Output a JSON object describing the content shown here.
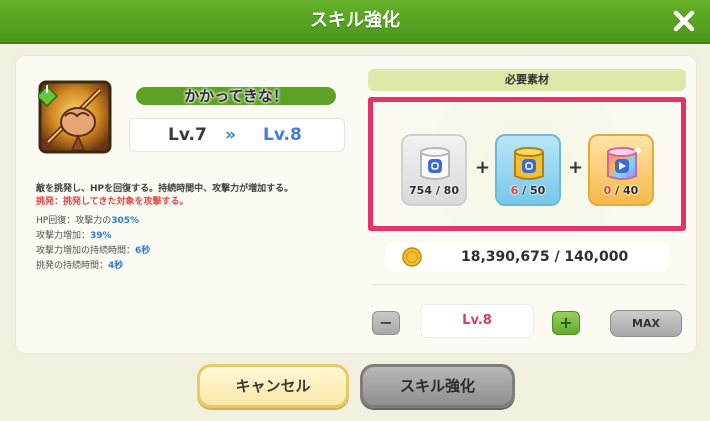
{
  "header": {
    "title": "スキル強化",
    "close_icon": "close-icon"
  },
  "skill": {
    "icon": "skill-fist-icon",
    "name": "かかってきな！",
    "level_current": "Lv.7",
    "level_arrows": "»",
    "level_next": "Lv.8",
    "description": "敵を挑発し、HPを回復する。持続時間中、攻撃力が増加する。",
    "description_note": "挑発：挑発してきた対象を攻撃する。",
    "stats": [
      {
        "label": "HP回復：攻撃力の",
        "value": "305%"
      },
      {
        "label": "攻撃力増加：",
        "value": "39%"
      },
      {
        "label": "攻撃力増加の持続時間：",
        "value": "6秒"
      },
      {
        "label": "挑発の持続時間：",
        "value": "4秒"
      }
    ]
  },
  "materials": {
    "header": "必要素材",
    "items": [
      {
        "icon": "white-jelly-icon",
        "have": "754",
        "separator": " / ",
        "need": "80",
        "lacking": false
      },
      {
        "icon": "gold-jelly-icon",
        "have": "6",
        "separator": " / ",
        "need": "50",
        "lacking": true
      },
      {
        "icon": "rainbow-jelly-icon",
        "have": "0",
        "separator": " / ",
        "need": "40",
        "lacking": true
      }
    ],
    "plus_sign": "+"
  },
  "coins": {
    "icon": "coin-icon",
    "text": "18,390,675 / 140,000"
  },
  "level_control": {
    "minus_label": "−",
    "value": "Lv.8",
    "plus_label": "+",
    "max_label": "MAX"
  },
  "buttons": {
    "cancel": "キャンセル",
    "enhance": "スキル強化"
  },
  "colors": {
    "header_green": "#4b961c",
    "highlight_frame": "#e53369",
    "level_blue": "#3f7fd8",
    "level_input_pink": "#e0386a",
    "lack_red": "#e23c3c"
  }
}
